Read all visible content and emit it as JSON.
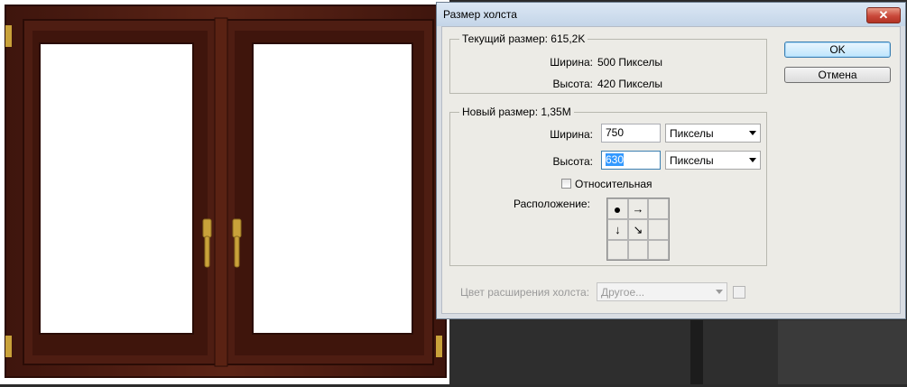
{
  "dialog": {
    "title": "Размер холста",
    "close_glyph": "✕",
    "ok_label": "OK",
    "cancel_label": "Отмена"
  },
  "current": {
    "legend": "Текущий размер: 615,2K",
    "width_label": "Ширина:",
    "width_value": "500 Пикселы",
    "height_label": "Высота:",
    "height_value": "420 Пикселы"
  },
  "new_size": {
    "legend": "Новый размер: 1,35M",
    "width_label": "Ширина:",
    "width_value": "750",
    "width_unit": "Пикселы",
    "height_label": "Высота:",
    "height_value": "630",
    "height_unit": "Пикселы",
    "relative_label": "Относительная",
    "relative_checked": false,
    "anchor_label": "Расположение:",
    "anchor_cells": [
      "•",
      "→",
      "",
      "↓",
      "↘",
      "",
      "",
      "",
      ""
    ]
  },
  "extension": {
    "label": "Цвет расширения холста:",
    "value": "Другое...",
    "disabled": true
  },
  "colors": {
    "wood": "#4b1c12",
    "wood_light": "#6a2a1a",
    "handle": "#c9a23a",
    "dialog_bg": "#ecebe6"
  }
}
